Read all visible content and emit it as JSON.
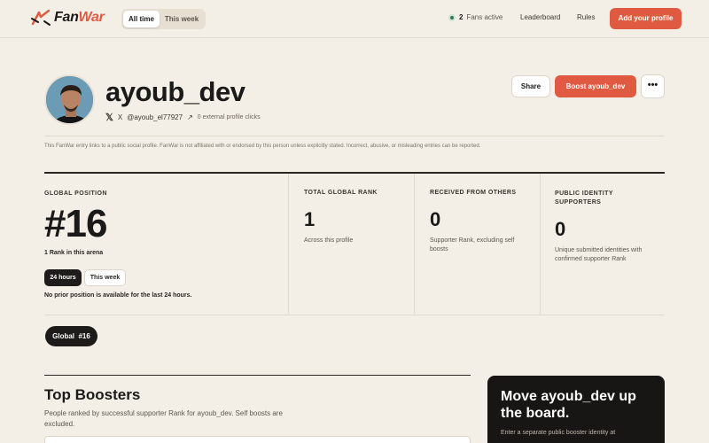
{
  "brand": {
    "name_part1": "Fan",
    "name_part2": "War"
  },
  "header": {
    "time_tabs": [
      "All time",
      "This week"
    ],
    "fans_count": "2",
    "fans_label": "Fans active",
    "nav": [
      "Leaderboard",
      "Rules"
    ],
    "cta": "Add your profile"
  },
  "profile": {
    "username": "ayoub_dev",
    "platform": "X",
    "handle": "@ayoub_el77927",
    "clicks": "0 external profile clicks",
    "share_label": "Share",
    "boost_label": "Boost ayoub_dev",
    "more_label": "•••"
  },
  "disclaimer": "This FanWar entry links to a public social profile. FanWar is not affiliated with or endorsed by this person unless explicitly stated. Incorrect, abusive, or misleading entries can be reported.",
  "stats": {
    "global_position_label": "GLOBAL POSITION",
    "global_position": "#16",
    "rank_in_arena": "1 Rank in this arena",
    "period_tabs": [
      "24 hours",
      "This week"
    ],
    "no_prior": "No prior position is available for the last 24 hours.",
    "total_rank_label": "TOTAL GLOBAL RANK",
    "total_rank": "1",
    "total_rank_sub": "Across this profile",
    "received_label": "RECEIVED FROM OTHERS",
    "received": "0",
    "received_sub": "Supporter Rank, excluding self boosts",
    "supporters_label": "PUBLIC IDENTITY SUPPORTERS",
    "supporters": "0",
    "supporters_sub": "Unique submitted identities with confirmed supporter Rank"
  },
  "badge": {
    "label": "Global",
    "value": "#16"
  },
  "boosters": {
    "title": "Top Boosters",
    "description": "People ranked by successful supporter Rank for ayoub_dev. Self boosts are excluded."
  },
  "promo": {
    "title": "Move ayoub_dev up the board.",
    "text": "Enter a separate public booster identity at"
  },
  "colors": {
    "accent": "#e05a42",
    "background": "#f4efe6",
    "dark": "#1e1c1a",
    "active_dot": "#2e7d4f"
  }
}
